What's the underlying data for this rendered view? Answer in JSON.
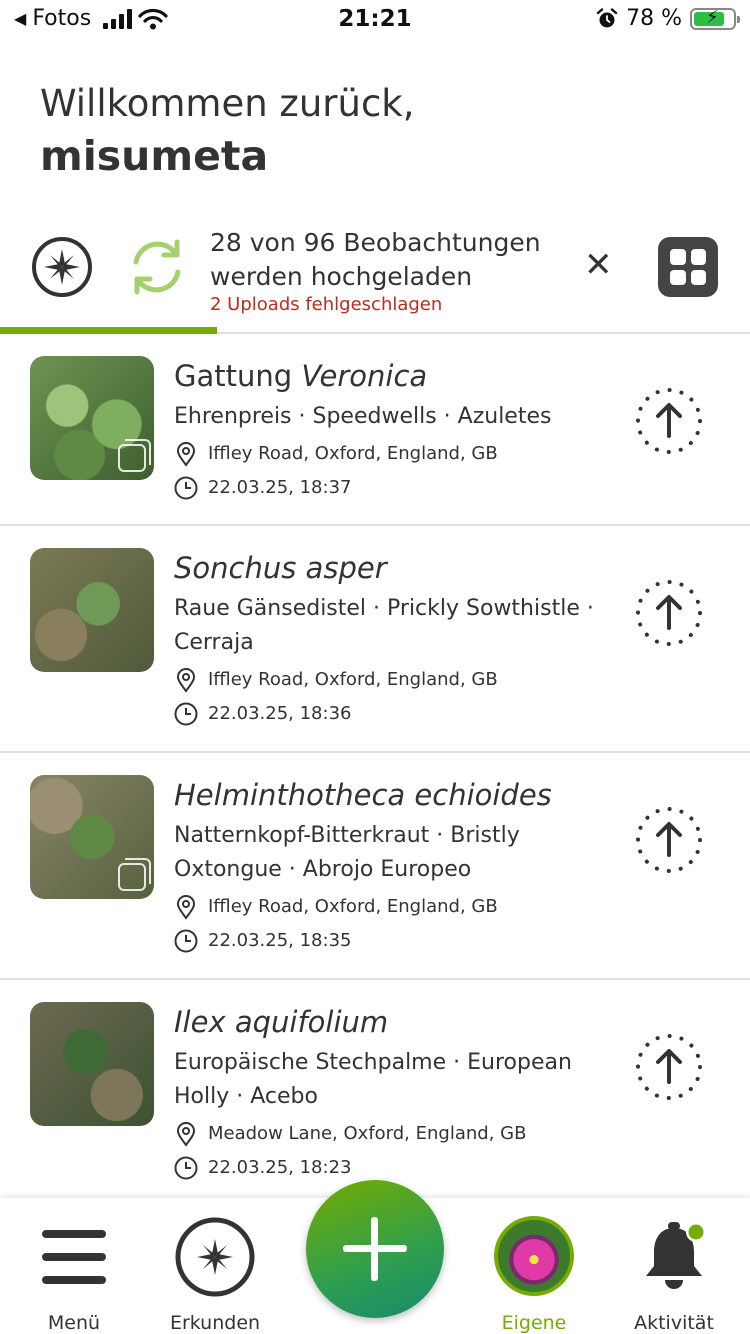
{
  "status_bar": {
    "back_label": "Fotos",
    "time": "21:21",
    "battery_percent": "78 %",
    "battery_level": 0.78
  },
  "greeting": {
    "line1": "Willkommen zurück,",
    "username": "misumeta"
  },
  "upload": {
    "title": "28 von 96 Beobachtungen werden hochgeladen",
    "failed": "2 Uploads fehlgeschlagen",
    "progress_fraction": 0.29
  },
  "observations": [
    {
      "rank": "Gattung ",
      "name": "Veronica",
      "common": "Ehrenpreis · Speedwells · Azuletes",
      "location": "Iffley Road, Oxford, England, GB",
      "datetime": "22.03.25,  18:37",
      "multi_photo": true
    },
    {
      "rank": "",
      "name": "Sonchus asper",
      "common": "Raue Gänsedistel · Prickly Sowthistle · Cerraja",
      "location": "Iffley Road, Oxford, England, GB",
      "datetime": "22.03.25,  18:36",
      "multi_photo": false
    },
    {
      "rank": "",
      "name": "Helminthotheca echioides",
      "common": "Natternkopf-Bitterkraut · Bristly Oxtongue · Abrojo Europeo",
      "location": "Iffley Road, Oxford, England, GB",
      "datetime": "22.03.25,  18:35",
      "multi_photo": true
    },
    {
      "rank": "",
      "name": "Ilex aquifolium",
      "common": "Europäische Stechpalme · European Holly · Acebo",
      "location": "Meadow Lane, Oxford, England, GB",
      "datetime": "22.03.25,  18:23",
      "multi_photo": false
    }
  ],
  "tabbar": {
    "menu": "Menü",
    "explore": "Erkunden",
    "own": "Eigene",
    "activity": "Aktivität"
  },
  "colors": {
    "accent": "#74ac00",
    "error": "#bf2a1e",
    "text": "#333333"
  }
}
